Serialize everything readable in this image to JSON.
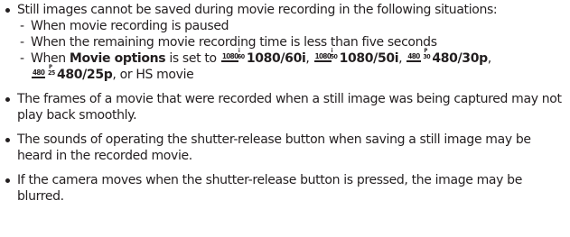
{
  "bullets": [
    {
      "text": "Still images cannot be saved during movie recording in the following situations:",
      "sub_items": [
        {
          "text": "When movie recording is paused"
        },
        {
          "text": "When the remaining movie recording time is less than five seconds"
        },
        {
          "prefix": "When ",
          "setting_name": "Movie options",
          "middle": " is set to ",
          "options": [
            {
              "icon_res": "1080",
              "icon_fps": "60",
              "icon_scan": "i",
              "label": "1080/60i",
              "sep": ", "
            },
            {
              "icon_res": "1080",
              "icon_fps": "50",
              "icon_scan": "i",
              "label": "1080/50i",
              "sep": ", "
            },
            {
              "icon_res": "480",
              "icon_fps": "30",
              "icon_scan": "P",
              "label": "480/30p",
              "sep": ","
            },
            {
              "icon_res": "480",
              "icon_fps": "25",
              "icon_scan": "P",
              "label": "480/25p",
              "sep": ", or HS movie"
            }
          ]
        }
      ]
    },
    {
      "text": "The frames of a movie that were recorded when a still image was being captured may not play back smoothly."
    },
    {
      "text": "The sounds of operating the shutter-release button when saving a still image may be heard in the recorded movie."
    },
    {
      "text": "If the camera moves when the shutter-release button is pressed, the image may be blurred."
    }
  ]
}
